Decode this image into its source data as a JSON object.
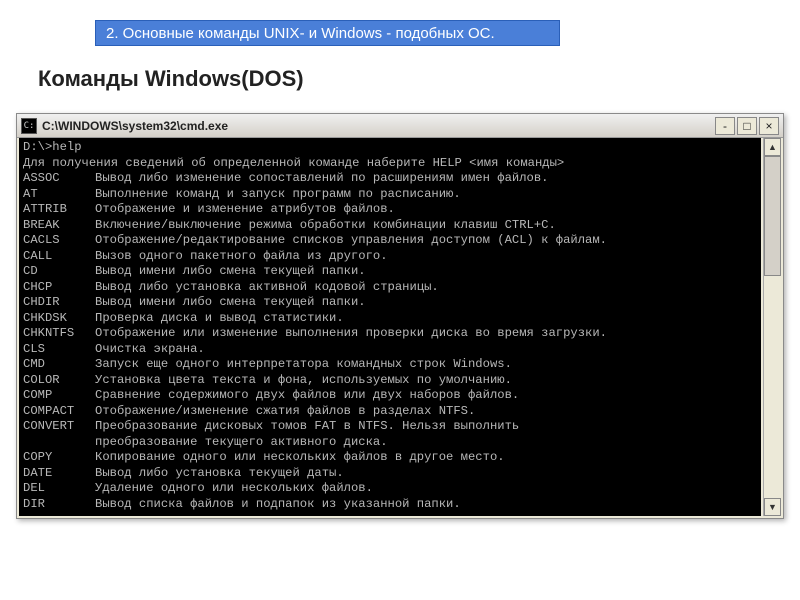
{
  "header": "2. Основные команды UNIX- и Windows - подобных ОС.",
  "section_title": "Команды Windows(DOS)",
  "window": {
    "title": "C:\\WINDOWS\\system32\\cmd.exe",
    "min": "‐",
    "max": "□",
    "close": "×"
  },
  "terminal": {
    "prompt": "D:\\>help",
    "intro": "Для получения сведений об определенной команде наберите HELP <имя команды>",
    "commands": [
      {
        "name": "ASSOC",
        "desc": "Вывод либо изменение сопоставлений по расширениям имен файлов."
      },
      {
        "name": "AT",
        "desc": "Выполнение команд и запуск программ по расписанию."
      },
      {
        "name": "ATTRIB",
        "desc": "Отображение и изменение атрибутов файлов."
      },
      {
        "name": "BREAK",
        "desc": "Включение/выключение режима обработки комбинации клавиш CTRL+C."
      },
      {
        "name": "CACLS",
        "desc": "Отображение/редактирование списков управления доступом (ACL) к файлам."
      },
      {
        "name": "CALL",
        "desc": "Вызов одного пакетного файла из другого."
      },
      {
        "name": "CD",
        "desc": "Вывод имени либо смена текущей папки."
      },
      {
        "name": "CHCP",
        "desc": "Вывод либо установка активной кодовой страницы."
      },
      {
        "name": "CHDIR",
        "desc": "Вывод имени либо смена текущей папки."
      },
      {
        "name": "CHKDSK",
        "desc": "Проверка диска и вывод статистики."
      },
      {
        "name": "CHKNTFS",
        "desc": "Отображение или изменение выполнения проверки диска во время загрузки."
      },
      {
        "name": "CLS",
        "desc": "Очистка экрана."
      },
      {
        "name": "CMD",
        "desc": "Запуск еще одного интерпретатора командных строк Windows."
      },
      {
        "name": "COLOR",
        "desc": "Установка цвета текста и фона, используемых по умолчанию."
      },
      {
        "name": "COMP",
        "desc": "Сравнение содержимого двух файлов или двух наборов файлов."
      },
      {
        "name": "COMPACT",
        "desc": "Отображение/изменение сжатия файлов в разделах NTFS."
      },
      {
        "name": "CONVERT",
        "desc": "Преобразование дисковых томов FAT в NTFS. Нельзя выполнить\nпреобразование текущего активного диска."
      },
      {
        "name": "COPY",
        "desc": "Копирование одного или нескольких файлов в другое место."
      },
      {
        "name": "DATE",
        "desc": "Вывод либо установка текущей даты."
      },
      {
        "name": "DEL",
        "desc": "Удаление одного или нескольких файлов."
      },
      {
        "name": "DIR",
        "desc": "Вывод списка файлов и подпапок из указанной папки."
      }
    ]
  }
}
